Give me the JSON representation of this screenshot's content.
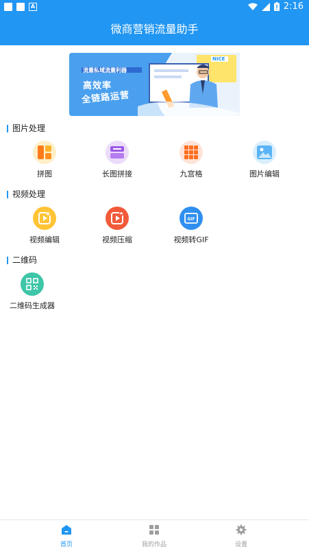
{
  "status_bar": {
    "time": "2:16",
    "notification_letter": "A"
  },
  "app_bar": {
    "title": "微商营销流量助手"
  },
  "banner": {
    "tag": "NICE",
    "subtitle": "流量私域流量利器",
    "line1": "高效率",
    "line2": "全链路运营"
  },
  "sections": [
    {
      "title": "图片处理",
      "items": [
        "拼图",
        "长图拼接",
        "九宫格",
        "图片编辑"
      ]
    },
    {
      "title": "视频处理",
      "items": [
        "视频编辑",
        "视频压缩",
        "视频转GIF"
      ]
    },
    {
      "title": "二维码",
      "items": [
        "二维码生成器"
      ]
    }
  ],
  "tabs": [
    {
      "label": "首页",
      "active": true
    },
    {
      "label": "我的作品",
      "active": false
    },
    {
      "label": "设置",
      "active": false
    }
  ],
  "colors": {
    "primary": "#2196f3",
    "tab_inactive": "#9e9e9e"
  }
}
